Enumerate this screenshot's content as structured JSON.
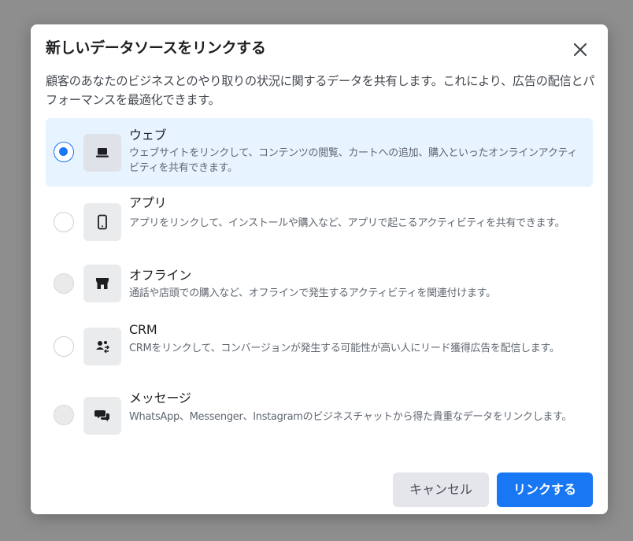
{
  "dialog": {
    "title": "新しいデータソースをリンクする",
    "description": "顧客のあなたのビジネスとのやり取りの状況に関するデータを共有します。これにより、広告の配信とパフォーマンスを最適化できます。",
    "options": [
      {
        "title": "ウェブ",
        "description": "ウェブサイトをリンクして、コンテンツの閲覧、カートへの追加、購入といったオンラインアクティビティを共有できます。",
        "icon": "laptop-icon",
        "state": "selected"
      },
      {
        "title": "アプリ",
        "description": "アプリをリンクして、インストールや購入など、アプリで起こるアクティビティを共有できます。",
        "icon": "mobile-phone-icon",
        "state": "unselected"
      },
      {
        "title": "オフライン",
        "description": "通話や店頭での購入など、オフラインで発生するアクティビティを関連付けます。",
        "icon": "store-icon",
        "state": "disabled"
      },
      {
        "title": "CRM",
        "description": "CRMをリンクして、コンバージョンが発生する可能性が高い人にリード獲得広告を配信します。",
        "icon": "people-sync-icon",
        "state": "unselected"
      },
      {
        "title": "メッセージ",
        "description": "WhatsApp、Messenger、Instagramのビジネスチャットから得た貴重なデータをリンクします。",
        "icon": "chat-bubbles-icon",
        "state": "disabled"
      }
    ],
    "buttons": {
      "cancel": "キャンセル",
      "confirm": "リンクする"
    }
  },
  "colors": {
    "accent": "#1877f2",
    "selected_bg": "#e7f3ff",
    "overlay": "#8e8e8e"
  }
}
